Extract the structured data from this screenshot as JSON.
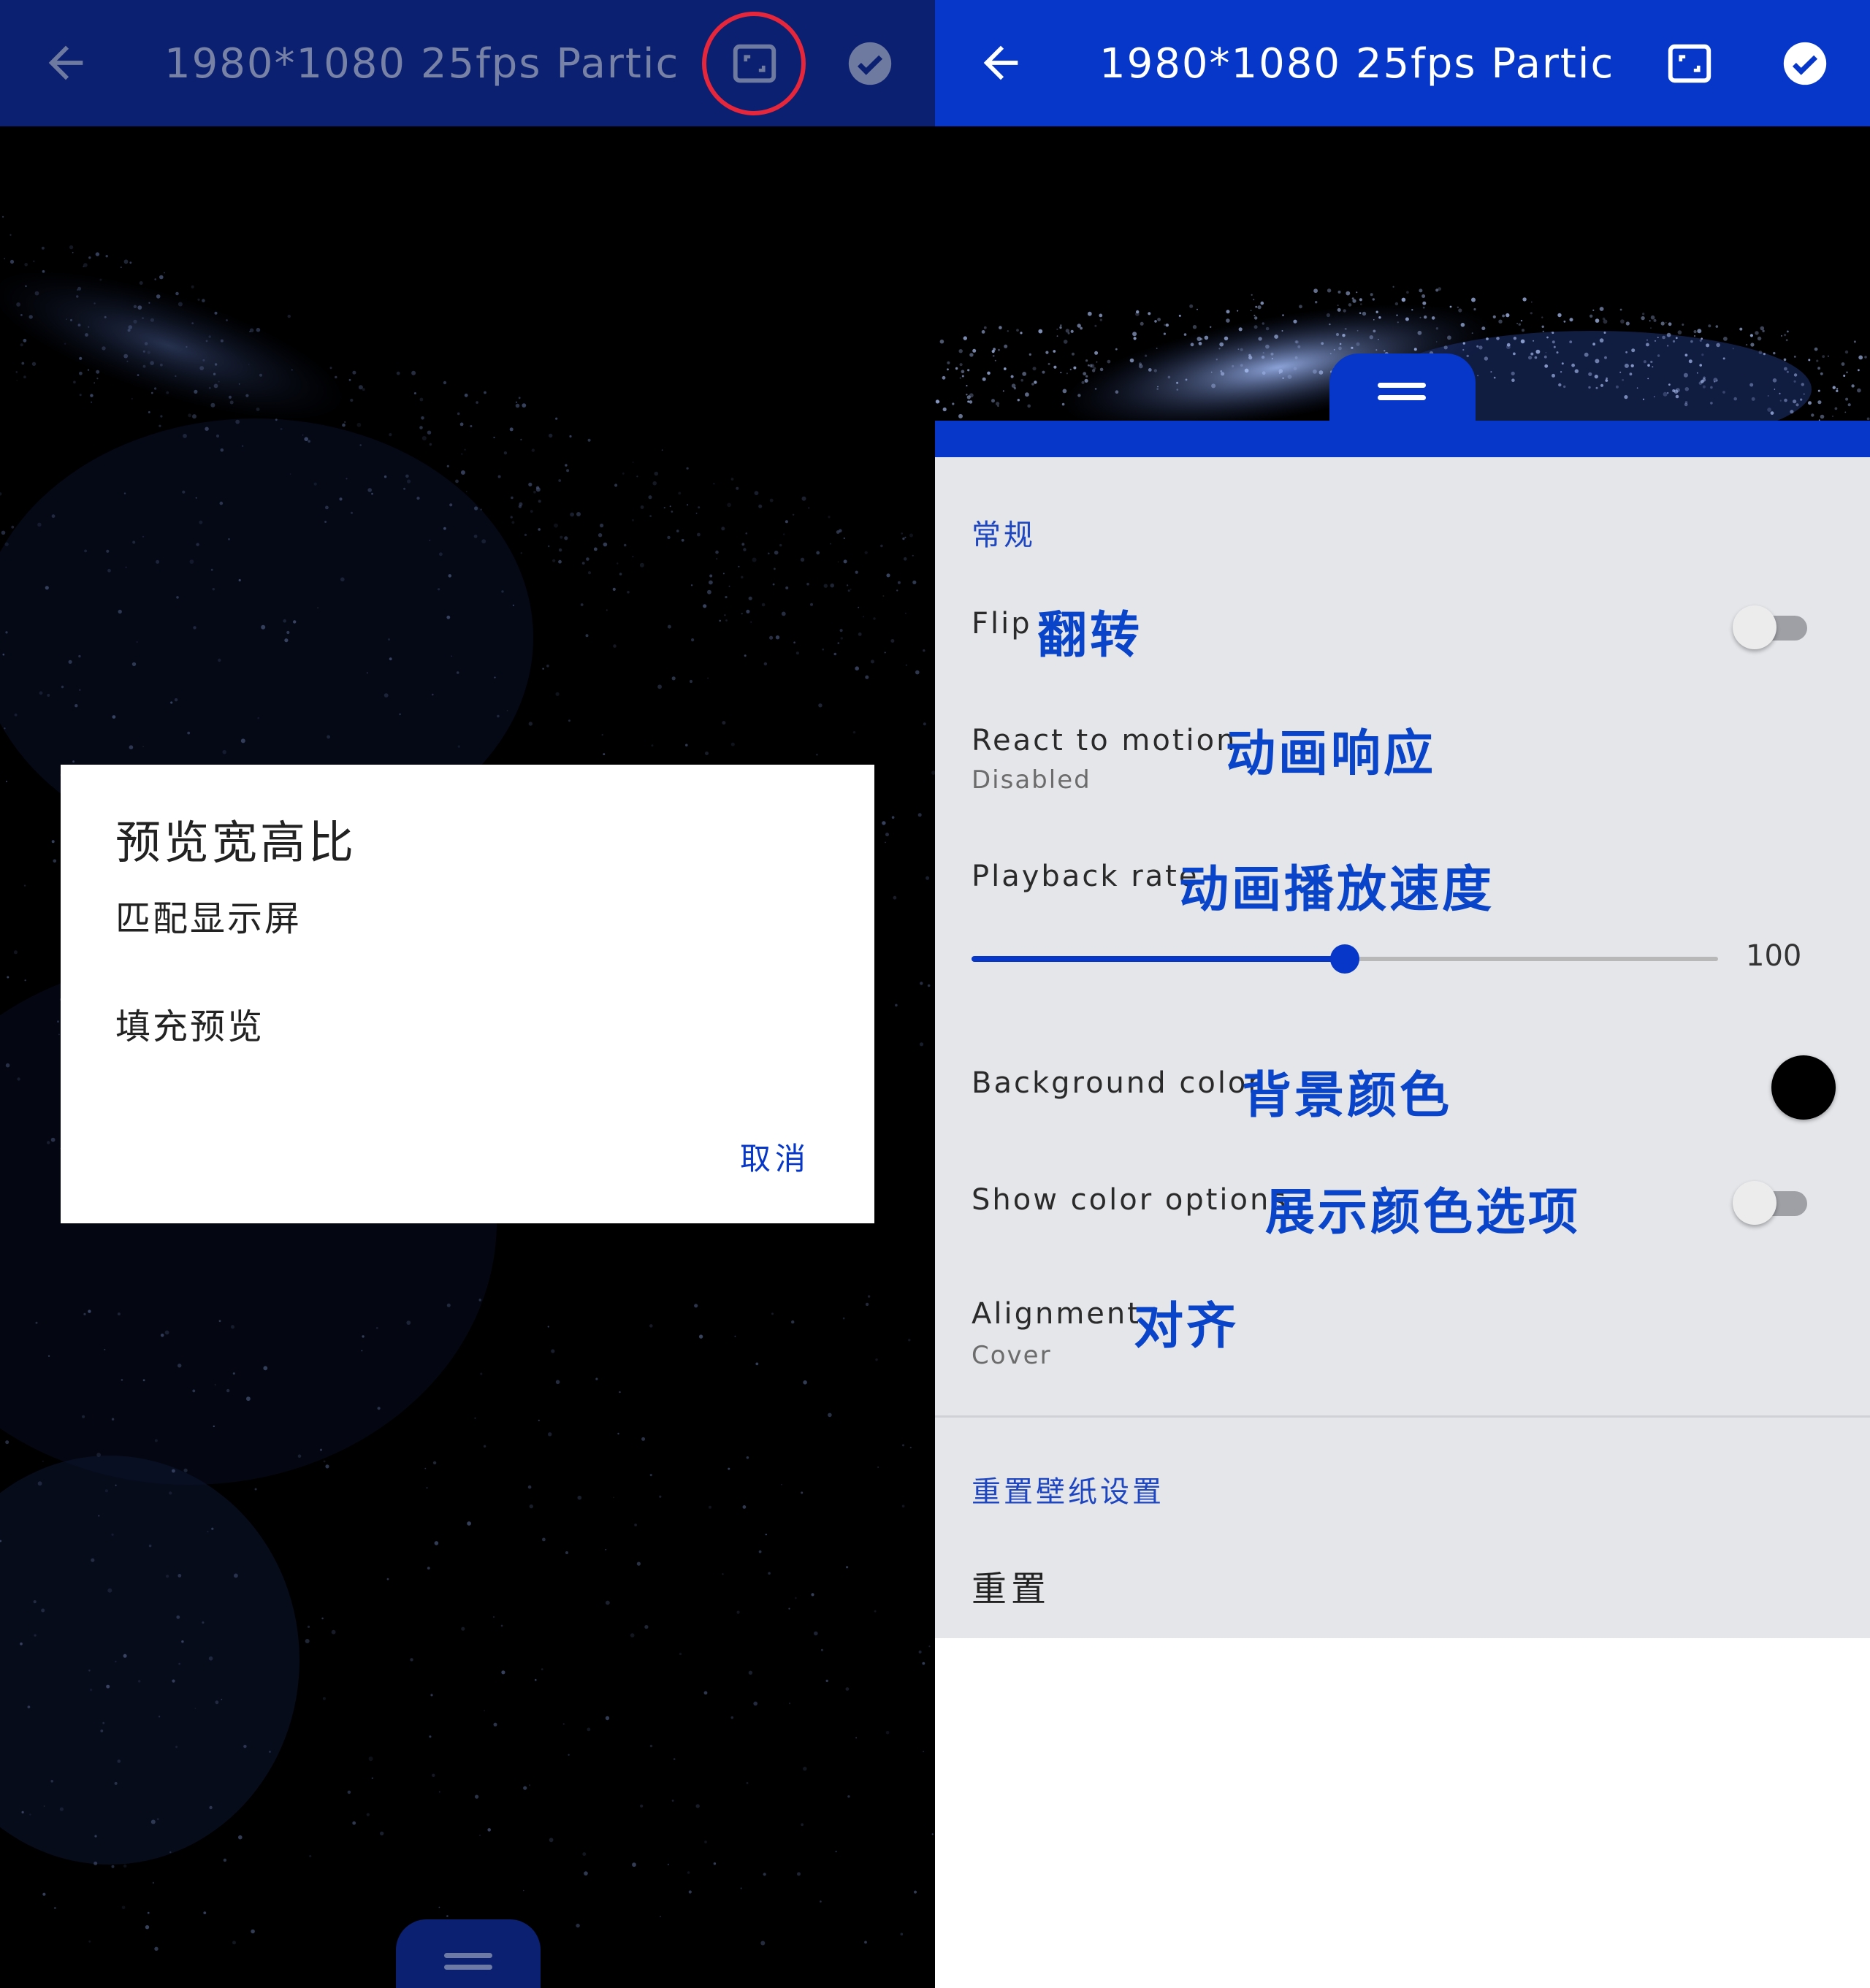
{
  "left_screen": {
    "toolbar": {
      "title": "1980*1080 25fps Particl···",
      "back_icon": "arrow-left-icon",
      "aspect_icon": "aspect-ratio-icon",
      "check_icon": "check-circle-icon"
    },
    "highlight_color": "#e5263b",
    "dialog": {
      "title": "预览宽高比",
      "options": [
        "匹配显示屏",
        "填充预览"
      ],
      "cancel_label": "取消"
    }
  },
  "right_screen": {
    "toolbar": {
      "title": "1980*1080 25fps Particl···",
      "back_icon": "arrow-left-icon",
      "aspect_icon": "aspect-ratio-icon",
      "check_icon": "check-circle-icon"
    },
    "settings": {
      "general_header": "常规",
      "flip": {
        "title": "Flip",
        "annotation": "翻转",
        "enabled": false
      },
      "react_to_motion": {
        "title": "React to motion",
        "annotation": "动画响应",
        "summary": "Disabled"
      },
      "playback_rate": {
        "title": "Playback rate",
        "annotation": "动画播放速度",
        "value": "100",
        "slider_fraction": 0.5
      },
      "background_color": {
        "title": "Background color",
        "annotation": "背景颜色",
        "color": "#000000"
      },
      "show_color_options": {
        "title": "Show color options",
        "annotation": "展示颜色选项",
        "enabled": false
      },
      "alignment": {
        "title": "Alignment",
        "annotation": "对齐",
        "summary": "Cover"
      },
      "reset_header": "重置壁纸设置",
      "reset_label": "重置"
    }
  },
  "colors": {
    "left_toolbar": "#0b2070",
    "right_toolbar": "#0637c8",
    "annotation_blue": "#0a44c8",
    "sheet_background": "#e4e6ea"
  }
}
